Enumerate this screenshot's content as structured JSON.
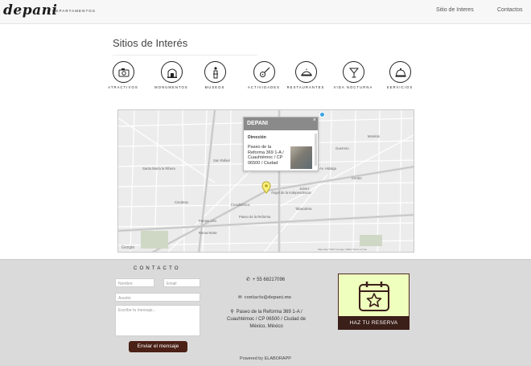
{
  "header": {
    "logo_text": "depani",
    "logo_sub": "DEPARTAMENTOS",
    "nav": [
      "Sitio de Interes",
      "Contactos"
    ]
  },
  "section": {
    "title": "Sitios de Interés",
    "icons": [
      {
        "label": "ATRACTIVOS",
        "icon": "camera-icon"
      },
      {
        "label": "MONUMENTOS",
        "icon": "monument-icon"
      },
      {
        "label": "MUSEOS",
        "icon": "museum-icon"
      },
      {
        "label": "ACTIVIDADES",
        "icon": "guitar-icon"
      },
      {
        "label": "RESTAURANTES",
        "icon": "restaurant-icon"
      },
      {
        "label": "VIDA NOCTURNA",
        "icon": "cocktail-icon"
      },
      {
        "label": "SERVICIOS",
        "icon": "service-bell-icon"
      }
    ]
  },
  "map": {
    "popup_title": "DEPANI",
    "popup_sub": "Dirección",
    "popup_address": "Paseo de la Reforma 369 1-A / Cuauhtémoc / CP 06500 / Ciudad",
    "labels": [
      "Condesa",
      "Roma Norte",
      "Juárez",
      "Cuauhtémoc",
      "Guerrero",
      "Morelos",
      "Centro",
      "Paseo de la Reforma",
      "Av. Hidalgo",
      "Ángel de la Independencia",
      "Parque Lira",
      "San Rafael",
      "Tabacalera",
      "Santa María la Ribera"
    ],
    "google": "Google",
    "credits": "Map data ©2017 Google, INEGI  Terms of Use"
  },
  "footer": {
    "contact_title": "CONTACTO",
    "name_placeholder": "Nombre",
    "email_placeholder": "Email",
    "subject_placeholder": "Asunto",
    "message_placeholder": "Escribe tu mensaje...",
    "send_label": "Enviar el mensaje",
    "phone": "+ 55 68217096",
    "email": "contacto@depani.mx",
    "address": "Paseo de la Reforma 369 1-A / Cuauhtémoc / CP 06500 / Ciudad de México, México",
    "reserve_label": "HAZ TU RESERVA",
    "powered": "Powered by ELABORAPP"
  },
  "colors": {
    "brown": "#4b2016",
    "reserve_bg": "#efffbd",
    "footer_bg": "#dadada",
    "popup_head": "#8a8a8a"
  }
}
